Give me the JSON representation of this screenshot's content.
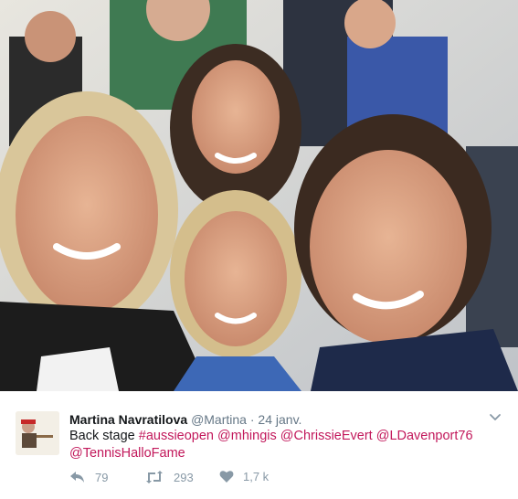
{
  "photo": {
    "alt_icon": "group-selfie-photo",
    "colors": {
      "background": "#d9d8d3",
      "skin": "#d9a07f",
      "hair_blonde": "#d9c69a",
      "hair_dark": "#4a3a30"
    }
  },
  "tweet": {
    "author_name": "Martina Navratilova",
    "author_handle": "@Martina",
    "separator": "·",
    "date": "24 janv.",
    "text_prefix": "Back stage ",
    "links": [
      "#aussieopen",
      "@mhingis",
      "@ChrissieEvert",
      "@LDavenport76",
      "@TennisHalloFame"
    ],
    "link_color": "#c2185b",
    "actions": {
      "reply_count": "79",
      "retweet_count": "293",
      "like_count": "1,7 k"
    }
  }
}
